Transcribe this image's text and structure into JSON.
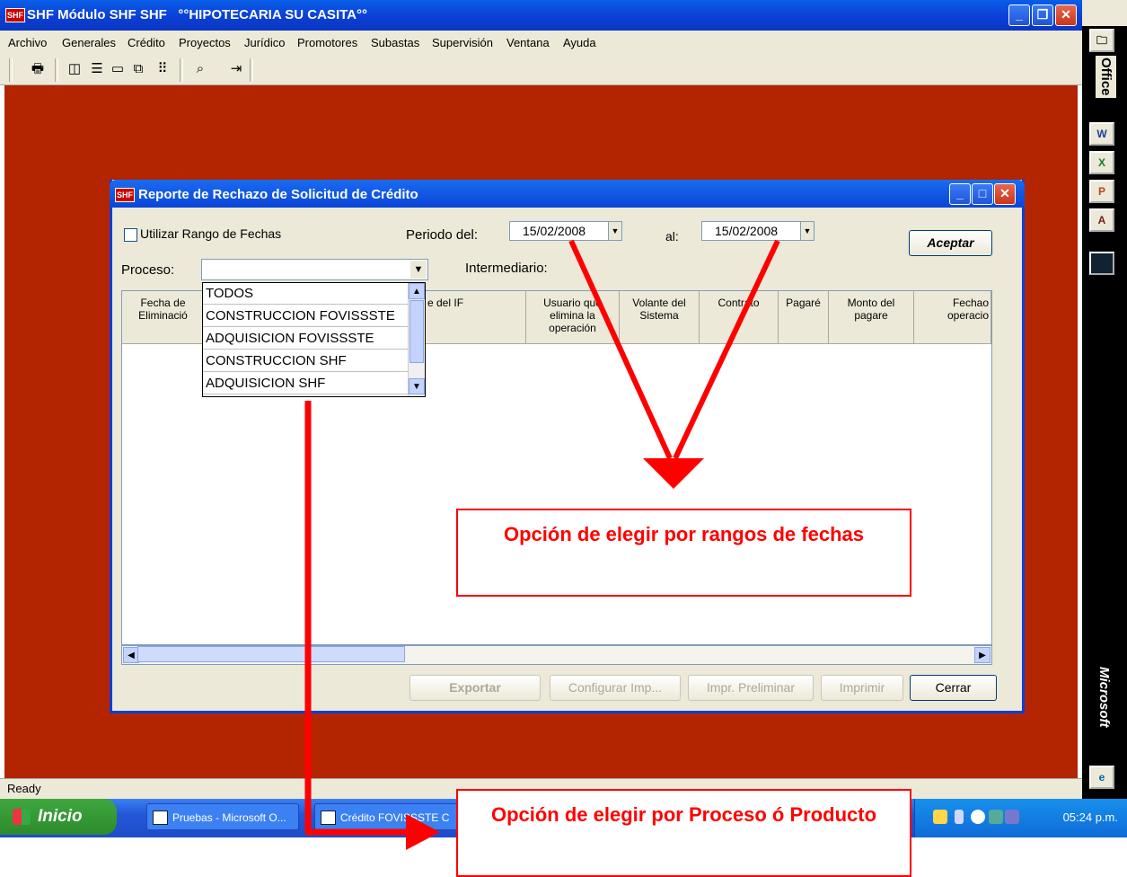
{
  "main_window": {
    "app_logo": "SHF",
    "title": "SHF Módulo SHF SHF   °°HIPOTECARIA SU CASITA°°",
    "minimize": "_",
    "restore": "❐",
    "close": "✕"
  },
  "menu": {
    "items": [
      "Archivo",
      "Generales",
      "Crédito",
      "Proyectos",
      "Jurídico",
      "Promotores",
      "Subastas",
      "Supervisión",
      "Ventana",
      "Ayuda"
    ]
  },
  "toolbar": {
    "icons": [
      "printer-icon",
      "tile-vertical-icon",
      "tile-horizontal-icon",
      "window-icon",
      "cascade-icon",
      "grid-dots-icon",
      "search-icon",
      "exit-door-icon"
    ]
  },
  "status": {
    "text": "Ready"
  },
  "office_bar": {
    "top_label": "Office",
    "bottom_label": "Microsoft",
    "buttons": [
      "W",
      "X",
      "P",
      "A",
      ""
    ]
  },
  "dialog": {
    "logo": "SHF",
    "title": "Reporte de Rechazo de Solicitud de Crédito",
    "use_range_label": "Utilizar Rango de Fechas",
    "periodo_label": "Periodo del:",
    "date_from": "15/02/2008",
    "al_label": "al:",
    "date_to": "15/02/2008",
    "accept_button": "Aceptar",
    "proceso_label": "Proceso:",
    "proceso_value": "",
    "intermediario_label": "Intermediario:",
    "proceso_options": [
      "TODOS",
      "CONSTRUCCION FOVISSSTE",
      "ADQUISICION FOVISSSTE",
      "CONSTRUCCION SHF",
      "ADQUISICION SHF"
    ],
    "columns": [
      "Fecha de Eliminació",
      "e del IF",
      "Usuario que elimina la operación",
      "Volante del Sistema",
      "Contrato",
      "Pagaré",
      "Monto del pagare",
      "Fechao operacio"
    ],
    "buttons": {
      "exportar": "Exportar",
      "configurar": "Configurar Imp...",
      "preliminar": "Impr. Preliminar",
      "imprimir": "Imprimir",
      "cerrar": "Cerrar"
    }
  },
  "annotations": {
    "dates": "Opción de elegir por rangos de fechas",
    "process": "Opción de elegir por Proceso ó Producto"
  },
  "taskbar": {
    "start_label": "Inicio",
    "tasks": [
      "Pruebas - Microsoft O...",
      "Crédito FOVISSSTE C"
    ],
    "clock": "05:24 p.m."
  },
  "colors": {
    "workspace": "#b32400",
    "titlebar": "#0b3fd6",
    "annotation": "#ff0000"
  }
}
